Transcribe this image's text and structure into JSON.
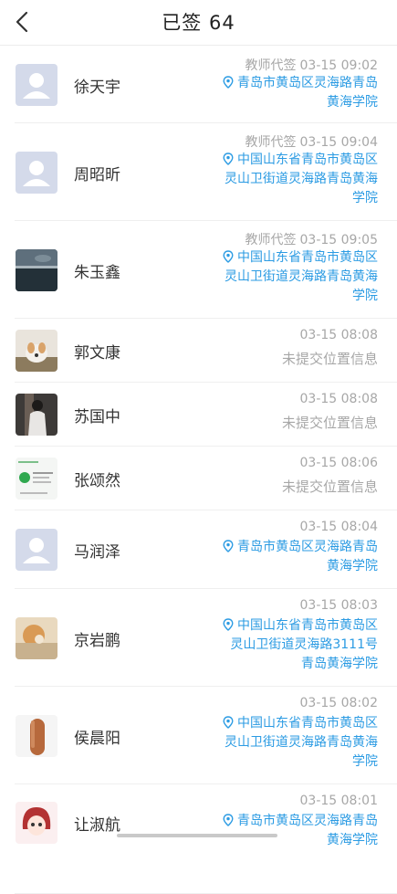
{
  "header": {
    "title": "已签  64"
  },
  "records": [
    {
      "name": "徐天宇",
      "signed_by": "教师代签",
      "time": "03-15 09:02",
      "location": "青岛市黄岛区灵海路青岛黄海学院",
      "no_location": "",
      "avatar": "default"
    },
    {
      "name": "周昭昕",
      "signed_by": "教师代签",
      "time": "03-15 09:04",
      "location": "中国山东省青岛市黄岛区灵山卫街道灵海路青岛黄海学院",
      "no_location": "",
      "avatar": "default"
    },
    {
      "name": "朱玉鑫",
      "signed_by": "教师代签",
      "time": "03-15 09:05",
      "location": "中国山东省青岛市黄岛区灵山卫街道灵海路青岛黄海学院",
      "no_location": "",
      "avatar": "sea"
    },
    {
      "name": "郭文康",
      "signed_by": "",
      "time": "03-15 08:08",
      "location": "",
      "no_location": "未提交位置信息",
      "avatar": "dog"
    },
    {
      "name": "苏国中",
      "signed_by": "",
      "time": "03-15 08:08",
      "location": "",
      "no_location": "未提交位置信息",
      "avatar": "person"
    },
    {
      "name": "张颂然",
      "signed_by": "",
      "time": "03-15 08:06",
      "location": "",
      "no_location": "未提交位置信息",
      "avatar": "doc"
    },
    {
      "name": "马润泽",
      "signed_by": "",
      "time": "03-15 08:04",
      "location": "青岛市黄岛区灵海路青岛黄海学院",
      "no_location": "",
      "avatar": "default"
    },
    {
      "name": "京岩鹏",
      "signed_by": "",
      "time": "03-15 08:03",
      "location": "中国山东省青岛市黄岛区灵山卫街道灵海路3111号青岛黄海学院",
      "no_location": "",
      "avatar": "painting"
    },
    {
      "name": "侯晨阳",
      "signed_by": "",
      "time": "03-15 08:02",
      "location": "中国山东省青岛市黄岛区灵山卫街道灵海路青岛黄海学院",
      "no_location": "",
      "avatar": "bottle"
    },
    {
      "name": "让淑航",
      "signed_by": "",
      "time": "03-15 08:01",
      "location": "青岛市黄岛区灵海路青岛黄海学院",
      "no_location": "",
      "avatar": "anime"
    }
  ],
  "colors": {
    "location_text": "#2b9be3",
    "muted_text": "#a7a7a7",
    "divider": "#efefef"
  }
}
